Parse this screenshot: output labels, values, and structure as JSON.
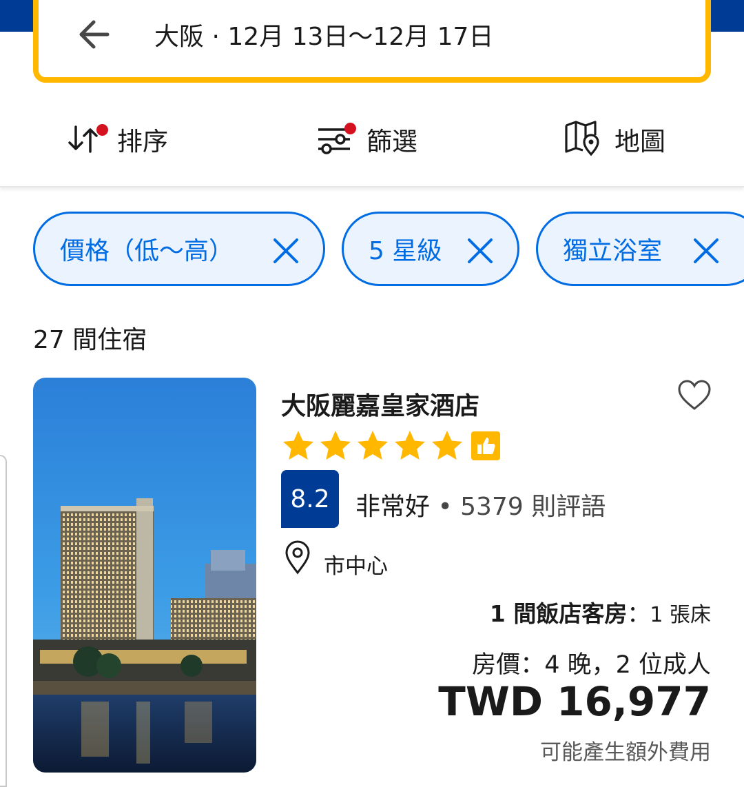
{
  "search": {
    "summary": "大阪 · 12月 13日～12月 17日"
  },
  "toolbar": {
    "sort_label": "排序",
    "filter_label": "篩選",
    "map_label": "地圖"
  },
  "chips": [
    {
      "label": "價格（低～高）"
    },
    {
      "label": "5 星級"
    },
    {
      "label": "獨立浴室"
    }
  ],
  "results": {
    "count_label": "27 間住宿"
  },
  "hotel": {
    "name": "大阪麗嘉皇家酒店",
    "stars": 5,
    "score": "8.2",
    "score_word": "非常好",
    "separator": " • ",
    "reviews": "5379 則評語",
    "location": "市中心",
    "room_bold": "1 間飯店客房",
    "room_sep": "：",
    "room_beds": "1 張床",
    "nights_label": "房價：",
    "nights_value": "4 晚，2 位成人",
    "price": "TWD 16,977",
    "extra_fees": "可能產生額外費用"
  },
  "colors": {
    "brand_blue": "#003b95",
    "accent_yellow": "#ffb700",
    "link_blue": "#006ce4",
    "alert_red": "#d4111e"
  }
}
